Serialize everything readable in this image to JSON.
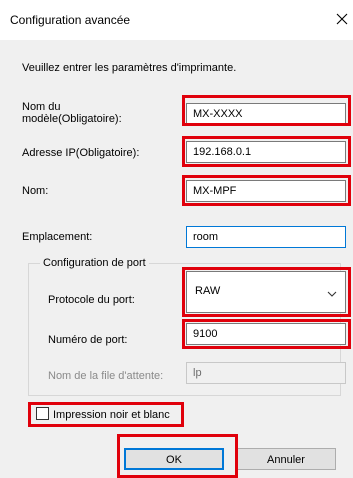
{
  "dialog": {
    "title": "Configuration avancée",
    "intro": "Veuillez entrer les paramètres d'imprimante."
  },
  "fields": {
    "model": {
      "label_line1": "Nom du",
      "label_line2": "modèle(Obligatoire):",
      "value": "MX-XXXX"
    },
    "ip": {
      "label": "Adresse IP(Obligatoire):",
      "value": "192.168.0.1"
    },
    "name": {
      "label": "Nom:",
      "value": "MX-MPF"
    },
    "location": {
      "label": "Emplacement:",
      "value": "room"
    }
  },
  "port_config": {
    "group_title": "Configuration de port",
    "protocol": {
      "label": "Protocole du port:",
      "value": "RAW"
    },
    "port_number": {
      "label": "Numéro de port:",
      "value": "9100"
    },
    "queue_name": {
      "label": "Nom de la file d'attente:",
      "value": "lp"
    }
  },
  "checkbox": {
    "label": "Impression noir et blanc",
    "checked": false
  },
  "buttons": {
    "ok": "OK",
    "cancel": "Annuler"
  },
  "colors": {
    "highlight": "#e0000b",
    "focus": "#0078d7",
    "dialog_bg": "#f0f0f0"
  },
  "icons": {
    "close": "close-icon",
    "dropdown": "chevron-down-icon"
  }
}
